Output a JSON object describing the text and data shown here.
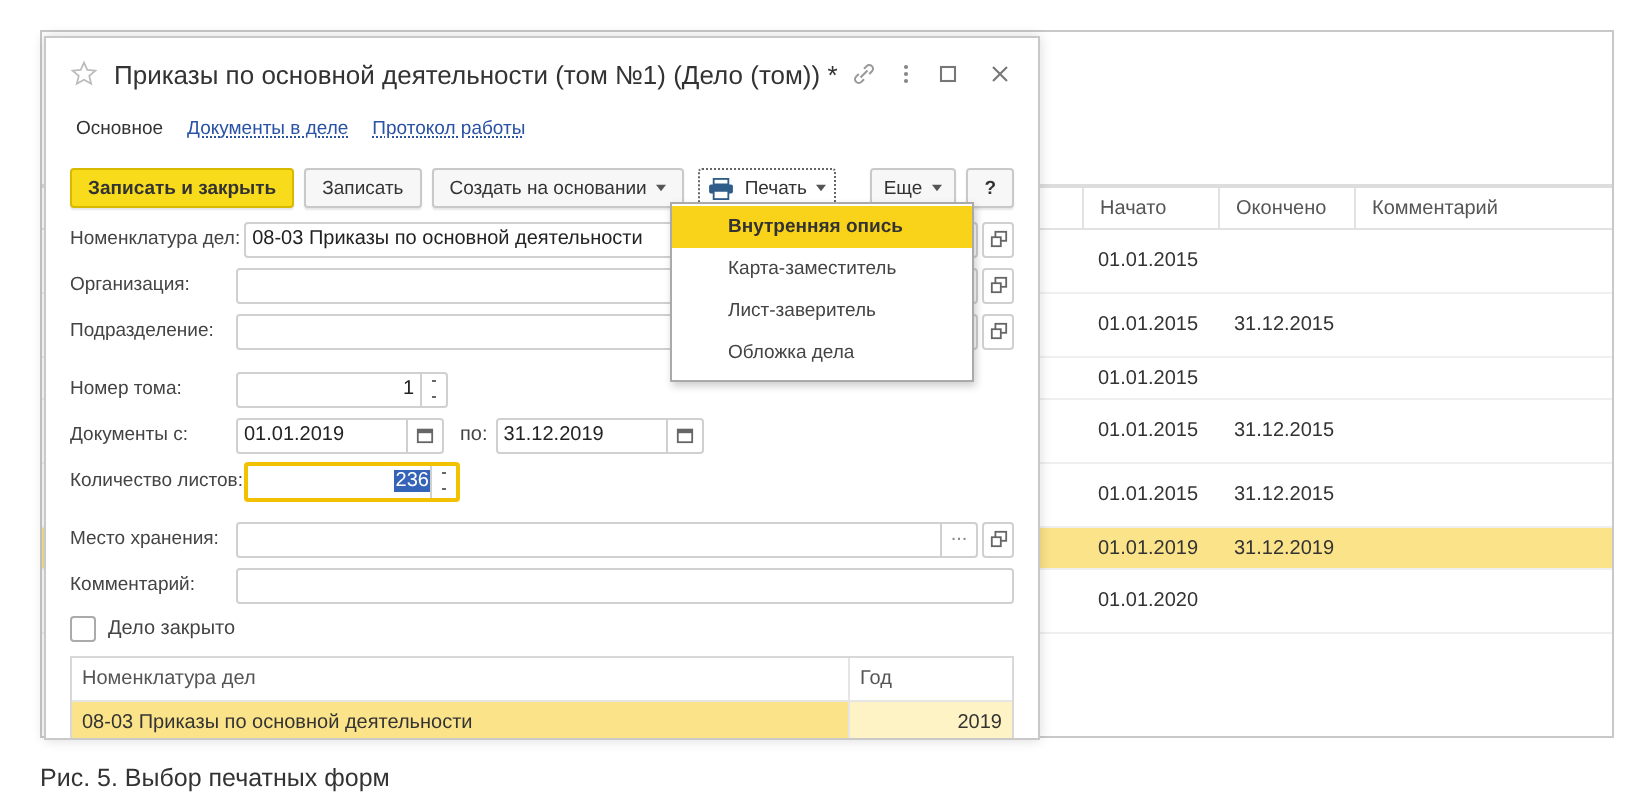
{
  "list": {
    "columns": [
      "Начато",
      "Окончено",
      "Комментарий"
    ],
    "rows": [
      {
        "cells": [
          "01.01.2015",
          "",
          ""
        ],
        "selected": false
      },
      {
        "cells": [
          "01.01.2015",
          "31.12.2015",
          ""
        ],
        "selected": false
      },
      {
        "cells": [
          "01.01.2015",
          "",
          ""
        ],
        "selected": false
      },
      {
        "cells": [
          "01.01.2015",
          "31.12.2015",
          ""
        ],
        "selected": false
      },
      {
        "cells": [
          "01.01.2015",
          "31.12.2015",
          ""
        ],
        "selected": false
      },
      {
        "cells": [
          "01.01.2019",
          "31.12.2019",
          ""
        ],
        "selected": true
      },
      {
        "cells": [
          "01.01.2020",
          "",
          ""
        ],
        "selected": false
      }
    ]
  },
  "dialog": {
    "title": "Приказы по основной деятельности (том №1) (Дело (том)) *",
    "favorite": false,
    "tabs": [
      {
        "label": "Основное",
        "selected": true
      },
      {
        "label": "Документы в деле",
        "selected": false
      },
      {
        "label": "Протокол работы",
        "selected": false
      }
    ],
    "toolbar": [
      {
        "label": "Записать и закрыть",
        "kind": "primary"
      },
      {
        "label": "Записать",
        "kind": "plain"
      },
      {
        "label": "Создать на основании",
        "kind": "dropdown"
      },
      {
        "label": "Печать",
        "kind": "print"
      },
      {
        "label": "Еще",
        "kind": "more"
      },
      {
        "label": "?",
        "kind": "help"
      }
    ],
    "print_menu": [
      {
        "label": "Внутренняя опись",
        "selected": true
      },
      {
        "label": "Карта-заместитель",
        "selected": false
      },
      {
        "label": "Лист-заверитель",
        "selected": false
      },
      {
        "label": "Обложка дела",
        "selected": false
      }
    ],
    "fields": [
      {
        "kind": "ref",
        "label": "Номенклатура дел:",
        "value": "08-03 Приказы по основной деятельности"
      },
      {
        "kind": "ref",
        "label": "Организация:"
      },
      {
        "kind": "ref",
        "label": "Подразделение:"
      },
      {
        "kind": "number",
        "label": "Номер тома:",
        "value": "1",
        "focused": false
      },
      {
        "kind": "dates",
        "label": "Документы с:",
        "value": "01.01.2019",
        "to_label": "по:",
        "to_value": "31.12.2019"
      },
      {
        "kind": "number",
        "label": "Количество листов:",
        "value": "236",
        "focused": true
      },
      {
        "kind": "choice",
        "label": "Место хранения:",
        "select_button": "..."
      },
      {
        "kind": "text",
        "label": "Комментарий:"
      }
    ],
    "closed": {
      "label": "Дело закрыто",
      "checked": false
    },
    "table": {
      "columns": [
        "Номенклатура дел",
        "Год"
      ],
      "rows": [
        {
          "cells": [
            "08-03 Приказы по основной деятельности",
            "2019"
          ],
          "selected": true
        }
      ]
    }
  },
  "caption": "Рис. 5. Выбор печатных форм"
}
